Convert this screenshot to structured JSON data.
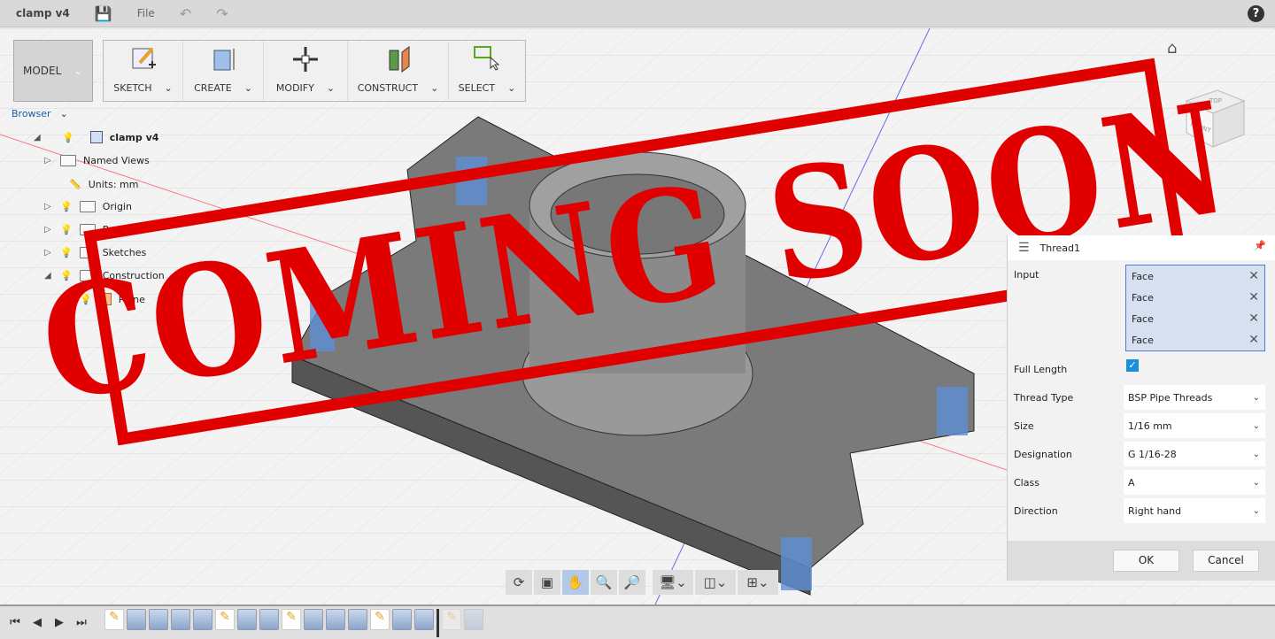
{
  "app": {
    "title": "clamp v4",
    "file_menu": "File",
    "help": "?"
  },
  "workspace": {
    "label": "MODEL"
  },
  "toolbar": [
    {
      "label": "SKETCH",
      "icon": "sketch-icon"
    },
    {
      "label": "CREATE",
      "icon": "extrude-icon"
    },
    {
      "label": "MODIFY",
      "icon": "move-icon"
    },
    {
      "label": "CONSTRUCT",
      "icon": "plane-icon"
    },
    {
      "label": "SELECT",
      "icon": "select-icon"
    }
  ],
  "browser": {
    "header": "Browser",
    "items": [
      {
        "label": "clamp v4"
      },
      {
        "label": "Named Views"
      },
      {
        "label": "Units: mm"
      },
      {
        "label": "Origin"
      },
      {
        "label": "Bodies"
      },
      {
        "label": "Sketches"
      },
      {
        "label": "Construction"
      },
      {
        "label": "Plane"
      }
    ]
  },
  "viewcube": {
    "top": "TOP",
    "front": "FRONT"
  },
  "stamp": {
    "text": "COMING SOON",
    "color": "#e00000"
  },
  "dialog": {
    "title": "Thread1",
    "input_label": "Input",
    "inputs": [
      "Face",
      "Face",
      "Face",
      "Face"
    ],
    "full_length_label": "Full Length",
    "full_length": true,
    "fields": [
      {
        "label": "Thread Type",
        "value": "BSP Pipe Threads"
      },
      {
        "label": "Size",
        "value": "1/16 mm"
      },
      {
        "label": "Designation",
        "value": "G 1/16-28"
      },
      {
        "label": "Class",
        "value": "A"
      },
      {
        "label": "Direction",
        "value": "Right hand"
      }
    ],
    "ok": "OK",
    "cancel": "Cancel"
  },
  "nav_tools": [
    "orbit",
    "look-at",
    "pan",
    "zoom",
    "fit",
    "display-settings",
    "visual-style",
    "viewports"
  ],
  "timeline": [
    "sketch",
    "extrude",
    "extrude",
    "fillet",
    "pattern",
    "sketch",
    "extrude",
    "fillet",
    "sketch",
    "extrude",
    "plane",
    "mirror",
    "sketch",
    "chamfer",
    "thread",
    "sketch-suppressed",
    "extrude-suppressed"
  ]
}
